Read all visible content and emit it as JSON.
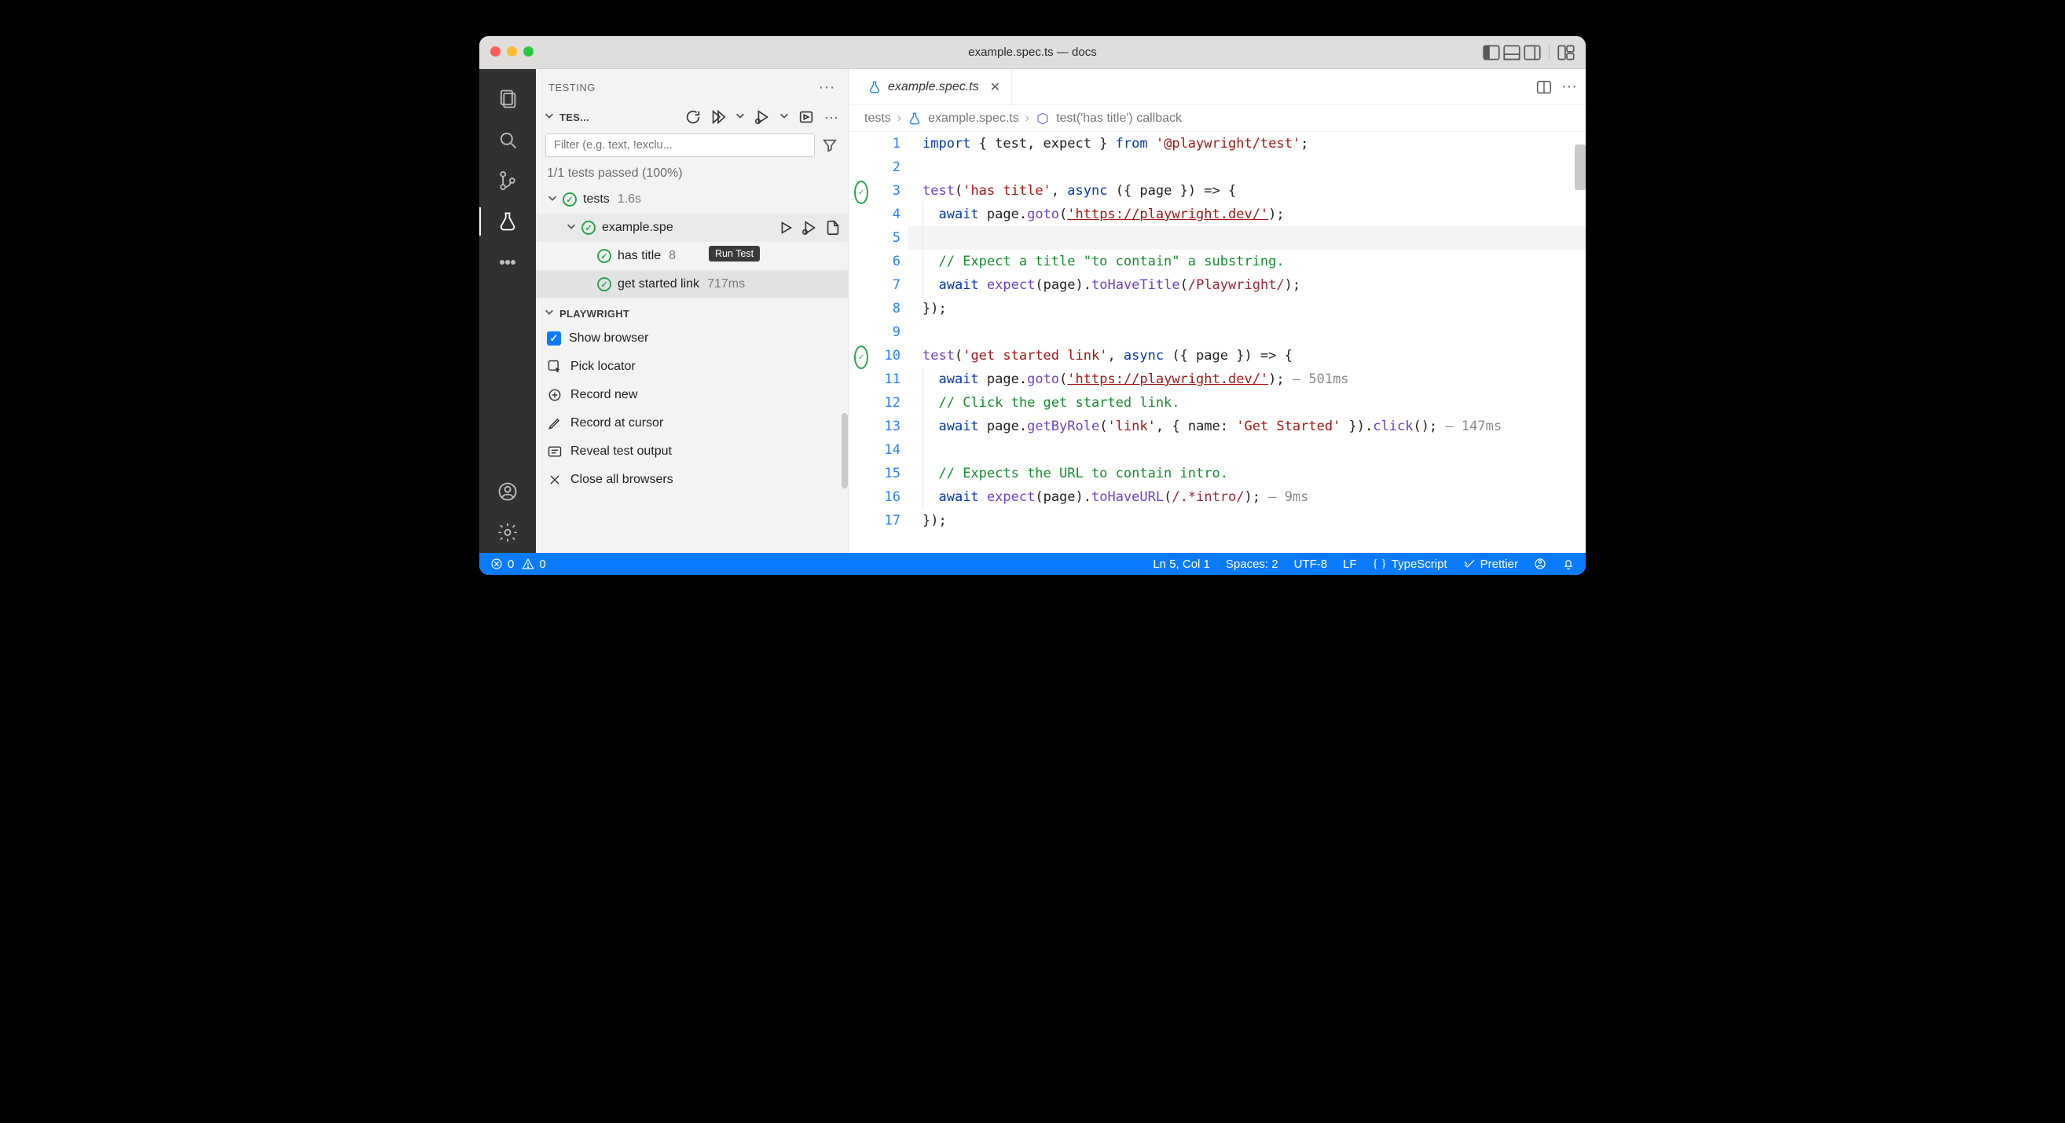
{
  "window": {
    "title": "example.spec.ts — docs"
  },
  "sidebar": {
    "header": "TESTING",
    "test_explorer": {
      "section_label": "TES...",
      "filter_placeholder": "Filter (e.g. text, !exclu...",
      "summary": "1/1 tests passed (100%)"
    },
    "tree": {
      "root": {
        "label": "tests",
        "time": "1.6s"
      },
      "file": {
        "label": "example.spe",
        "tooltip": "Run Test"
      },
      "tests": [
        {
          "label": "has title",
          "time": "8"
        },
        {
          "label": "get started link",
          "time": "717ms"
        }
      ]
    },
    "playwright": {
      "section_label": "PLAYWRIGHT",
      "items": {
        "show_browser": "Show browser",
        "pick_locator": "Pick locator",
        "record_new": "Record new",
        "record_at_cursor": "Record at cursor",
        "reveal_output": "Reveal test output",
        "close_all": "Close all browsers"
      }
    }
  },
  "tabs": {
    "active": "example.spec.ts"
  },
  "breadcrumb": {
    "folder": "tests",
    "file": "example.spec.ts",
    "symbol": "test('has title') callback"
  },
  "code": {
    "lines": [
      {
        "n": 1,
        "html": "<span class='kw'>import</span> { test, expect } <span class='kw'>from</span> <span class='str'>'@playwright/test'</span>;"
      },
      {
        "n": 2,
        "html": ""
      },
      {
        "n": 3,
        "mark": "pass",
        "html": "<span class='fn'>test</span>(<span class='str'>'has title'</span>, <span class='kw'>async</span> ({ page }) =&gt; {"
      },
      {
        "n": 4,
        "indent": 1,
        "html": "<span class='kw'>await</span> page.<span class='fn'>goto</span>(<span class='url'>'https://playwright.dev/'</span>);"
      },
      {
        "n": 5,
        "indent": 1,
        "current": true,
        "html": ""
      },
      {
        "n": 6,
        "indent": 1,
        "html": "<span class='cm'>// Expect a title \"to contain\" a substring.</span>"
      },
      {
        "n": 7,
        "indent": 1,
        "html": "<span class='kw'>await</span> <span class='fn'>expect</span>(page).<span class='fn'>toHaveTitle</span>(<span class='reg'>/Playwright/</span>);"
      },
      {
        "n": 8,
        "html": "});"
      },
      {
        "n": 9,
        "html": ""
      },
      {
        "n": 10,
        "mark": "pass",
        "html": "<span class='fn'>test</span>(<span class='str'>'get started link'</span>, <span class='kw'>async</span> ({ page }) =&gt; {"
      },
      {
        "n": 11,
        "indent": 1,
        "html": "<span class='kw'>await</span> page.<span class='fn'>goto</span>(<span class='url'>'https://playwright.dev/'</span>); <span class='hint'>— 501ms</span>"
      },
      {
        "n": 12,
        "indent": 1,
        "html": "<span class='cm'>// Click the get started link.</span>"
      },
      {
        "n": 13,
        "indent": 1,
        "html": "<span class='kw'>await</span> page.<span class='fn'>getByRole</span>(<span class='str'>'link'</span>, { name: <span class='str'>'Get Started'</span> }).<span class='fn'>click</span>(); <span class='hint'>— 147ms</span>"
      },
      {
        "n": 14,
        "indent": 1,
        "html": ""
      },
      {
        "n": 15,
        "indent": 1,
        "html": "<span class='cm'>// Expects the URL to contain intro.</span>"
      },
      {
        "n": 16,
        "indent": 1,
        "html": "<span class='kw'>await</span> <span class='fn'>expect</span>(page).<span class='fn'>toHaveURL</span>(<span class='reg'>/.*intro/</span>); <span class='hint'>— 9ms</span>"
      },
      {
        "n": 17,
        "html": "});"
      }
    ]
  },
  "statusbar": {
    "errors": "0",
    "warnings": "0",
    "cursor": "Ln 5, Col 1",
    "indent": "Spaces: 2",
    "encoding": "UTF-8",
    "eol": "LF",
    "language": "TypeScript",
    "prettier": "Prettier"
  }
}
